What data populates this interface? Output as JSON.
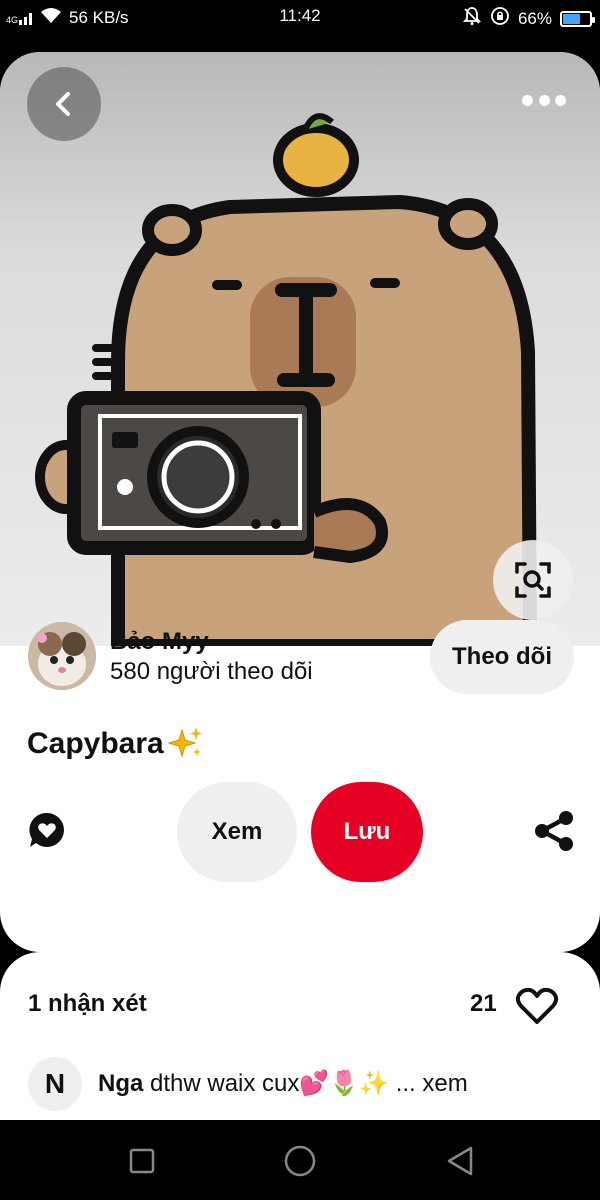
{
  "status_bar": {
    "signal_label": "4G",
    "network_speed": "56 KB/s",
    "time": "11:42",
    "battery_percent": "66%",
    "battery_level": 0.66
  },
  "pin": {
    "creator_name": "Bảo Myy",
    "creator_followers": "580 người theo dõi",
    "follow_label": "Theo dõi",
    "title": "Capybara",
    "view_label": "Xem",
    "save_label": "Lưu"
  },
  "comments": {
    "count_label": "1 nhận xét",
    "likes": "21",
    "items": [
      {
        "avatar_letter": "N",
        "author": "Nga",
        "text": "dthw waix cux💕🌷✨ ... xem"
      }
    ]
  },
  "colors": {
    "accent_red": "#e60023",
    "pill_gray": "#efefef"
  },
  "icons": [
    "back-arrow-icon",
    "more-icon",
    "visual-search-icon",
    "comment-bubble-icon",
    "share-icon",
    "heart-icon",
    "sparkles-icon"
  ]
}
